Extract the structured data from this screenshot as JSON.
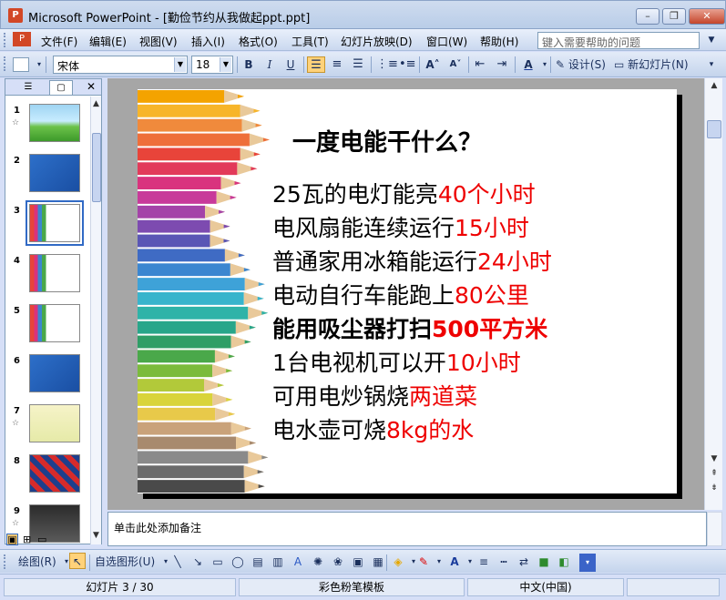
{
  "window": {
    "title": "Microsoft PowerPoint - [勤俭节约从我做起ppt.ppt]",
    "icon": "powerpoint-icon",
    "minimize": "–",
    "restore": "❐",
    "close": "✕"
  },
  "menu": {
    "items": [
      "文件(F)",
      "编辑(E)",
      "视图(V)",
      "插入(I)",
      "格式(O)",
      "工具(T)",
      "幻灯片放映(D)",
      "窗口(W)",
      "帮助(H)"
    ],
    "help_placeholder": "键入需要帮助的问题"
  },
  "toolbar": {
    "font_name": "宋体",
    "font_size": "18",
    "bold": "B",
    "italic": "I",
    "underline": "U",
    "design_label": "设计(S)",
    "new_slide_label": "新幻灯片(N)"
  },
  "slides_panel": {
    "tab_outline": "☰",
    "tab_slides": "▢",
    "close": "✕",
    "thumbnails": [
      {
        "num": "1",
        "star": "☆",
        "theme": "green"
      },
      {
        "num": "2",
        "star": "",
        "theme": "blue"
      },
      {
        "num": "3",
        "star": "",
        "theme": "pencils",
        "selected": true
      },
      {
        "num": "4",
        "star": "",
        "theme": "pencils"
      },
      {
        "num": "5",
        "star": "",
        "theme": "pencils"
      },
      {
        "num": "6",
        "star": "",
        "theme": "blue"
      },
      {
        "num": "7",
        "star": "☆",
        "theme": "yellow"
      },
      {
        "num": "8",
        "star": "",
        "theme": "red"
      },
      {
        "num": "9",
        "star": "☆",
        "theme": "dark"
      }
    ]
  },
  "slide": {
    "title": "一度电能干什么？",
    "lines": [
      {
        "text": "25瓦的电灯能亮",
        "highlight": "40个小时",
        "bold": false
      },
      {
        "text": "电风扇能连续运行",
        "highlight": "15小时",
        "bold": false
      },
      {
        "text": "普通家用冰箱能运行",
        "highlight": "24小时",
        "bold": false
      },
      {
        "text": "电动自行车能跑上",
        "highlight": "80公里",
        "bold": false
      },
      {
        "text": "能用吸尘器打扫",
        "highlight": "500平方米",
        "bold": true
      },
      {
        "text": "1台电视机可以开",
        "highlight": "10小时",
        "bold": false
      },
      {
        "text": "可用电炒锅烧",
        "highlight": "两道菜",
        "bold": false
      },
      {
        "text": "电水壶可烧",
        "highlight": "8kg的水",
        "bold": false
      }
    ]
  },
  "notes": {
    "placeholder": "单击此处添加备注"
  },
  "drawing_toolbar": {
    "draw_label": "绘图(R)",
    "autoshapes_label": "自选图形(U)"
  },
  "status": {
    "slide_info": "幻灯片 3 / 30",
    "template": "彩色粉笔模板",
    "language": "中文(中国)"
  }
}
